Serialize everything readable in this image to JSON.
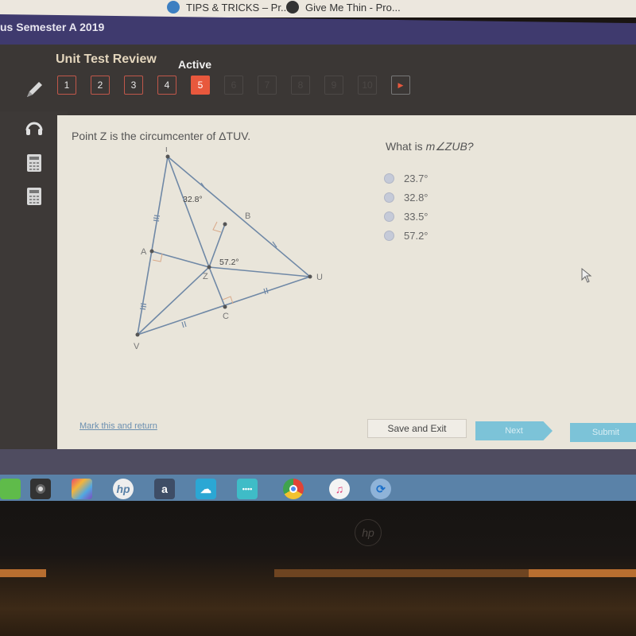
{
  "browser": {
    "bookmarks": [
      {
        "label": "TIPS & TRICKS – Pr...",
        "icon": "wordpress-icon"
      },
      {
        "label": "Give Me Thin - Pro...",
        "icon": "globe-icon"
      }
    ]
  },
  "course": {
    "title": "us Semester A 2019"
  },
  "activity": {
    "title": "Unit Test Review",
    "status": "Active",
    "questions": [
      {
        "label": "1",
        "state": "visited"
      },
      {
        "label": "2",
        "state": "visited"
      },
      {
        "label": "3",
        "state": "visited"
      },
      {
        "label": "4",
        "state": "visited"
      },
      {
        "label": "5",
        "state": "current"
      },
      {
        "label": "6",
        "state": "disabled"
      },
      {
        "label": "7",
        "state": "disabled"
      },
      {
        "label": "8",
        "state": "disabled"
      },
      {
        "label": "9",
        "state": "disabled"
      },
      {
        "label": "10",
        "state": "disabled"
      }
    ],
    "next_arrow": "▶"
  },
  "tools": [
    "pencil-icon",
    "headphones-icon",
    "calculator-icon",
    "calculator-icon"
  ],
  "problem": {
    "prompt": "Point Z is the circumcenter of ΔTUV.",
    "question_prefix": "What is ",
    "question_expr": "m∠ZUB?",
    "options": [
      "23.7°",
      "32.8°",
      "33.5°",
      "57.2°"
    ],
    "diagram": {
      "points": {
        "T": "T",
        "U": "U",
        "V": "V",
        "A": "A",
        "B": "B",
        "C": "C",
        "Z": "Z"
      },
      "angle_labels": {
        "at_T": "32.8°",
        "at_Z": "57.2°"
      }
    }
  },
  "footer": {
    "mark_link": "Mark this and return",
    "save_exit": "Save and Exit",
    "next": "Next",
    "submit": "Submit"
  },
  "taskbar": {
    "apps": [
      "app-icon",
      "webcam-icon",
      "games-icon",
      "hp-icon",
      "amazon-icon",
      "onedrive-icon",
      "network-icon",
      "chrome-icon",
      "itunes-icon",
      "sync-icon"
    ],
    "hp_text": "hp",
    "amazon_text": "a"
  },
  "bezel": {
    "logo": "hp"
  },
  "colors": {
    "accent": "#e8583d",
    "button_blue": "#7cc3d8",
    "header_purple": "#3f3a6e"
  }
}
